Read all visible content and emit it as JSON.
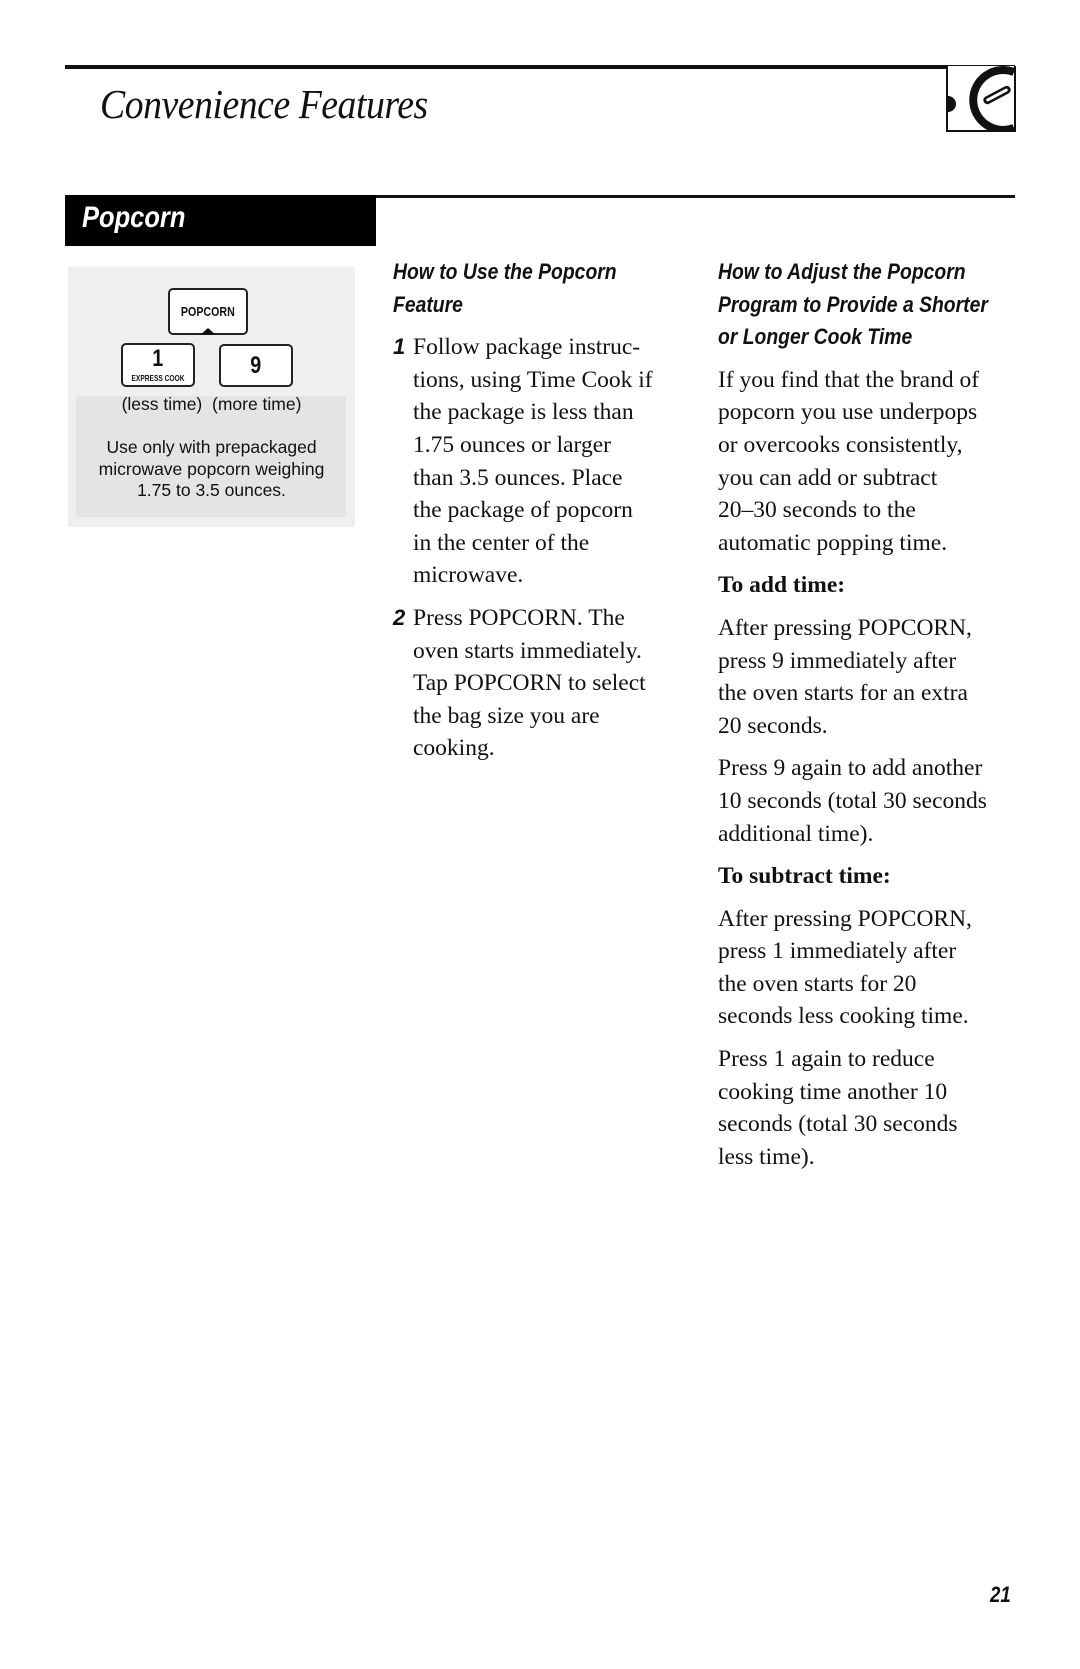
{
  "header": {
    "title": "Convenience Features",
    "chapter_icon": "clock-dial-icon"
  },
  "section": {
    "title": "Popcorn"
  },
  "panel": {
    "keys": {
      "popcorn": "POPCORN",
      "one_number": "1",
      "one_sublabel": "EXPRESS COOK",
      "nine": "9"
    },
    "time_labels": "(less time)  (more time)",
    "note_lines": [
      "Use only with prepackaged",
      "microwave popcorn weighing",
      "1.75 to 3.5 ounces."
    ]
  },
  "how_to_use": {
    "heading_lines": [
      "How to Use the Popcorn",
      "Feature"
    ],
    "steps": [
      {
        "number": "1",
        "lines": [
          "Follow package instruc-",
          "tions, using Time Cook if",
          "the package is less than",
          "1.75 ounces or larger",
          "than 3.5 ounces. Place",
          "the package of popcorn",
          "in the center of the",
          "microwave."
        ]
      },
      {
        "number": "2",
        "lines": [
          "Press POPCORN. The",
          "oven starts immediately.",
          "Tap POPCORN to select",
          "the bag size you are",
          "cooking."
        ]
      }
    ]
  },
  "how_to_adjust": {
    "heading_lines": [
      "How to Adjust the Popcorn",
      "Program to Provide a Shorter",
      "or Longer Cook Time"
    ],
    "intro_lines": [
      "If you find that the brand of",
      "popcorn you use underpops",
      "or overcooks consistently,",
      "you can add or subtract",
      "20–30 seconds to the",
      "automatic popping time."
    ],
    "add_time": {
      "heading": "To add time:",
      "para1_lines": [
        "After pressing POPCORN,",
        "press 9 immediately after",
        "the oven starts for an extra",
        "20 seconds."
      ],
      "para2_lines": [
        "Press 9 again to add another",
        "10 seconds (total 30 seconds",
        "additional time)."
      ]
    },
    "subtract_time": {
      "heading": "To subtract time:",
      "para1_lines": [
        "After pressing POPCORN,",
        "press 1 immediately after",
        "the oven starts for 20",
        "seconds less cooking time."
      ],
      "para2_lines": [
        "Press 1 again to reduce",
        "cooking time another 10",
        "seconds (total 30 seconds",
        "less time)."
      ]
    }
  },
  "footer": {
    "page_number": "21"
  }
}
